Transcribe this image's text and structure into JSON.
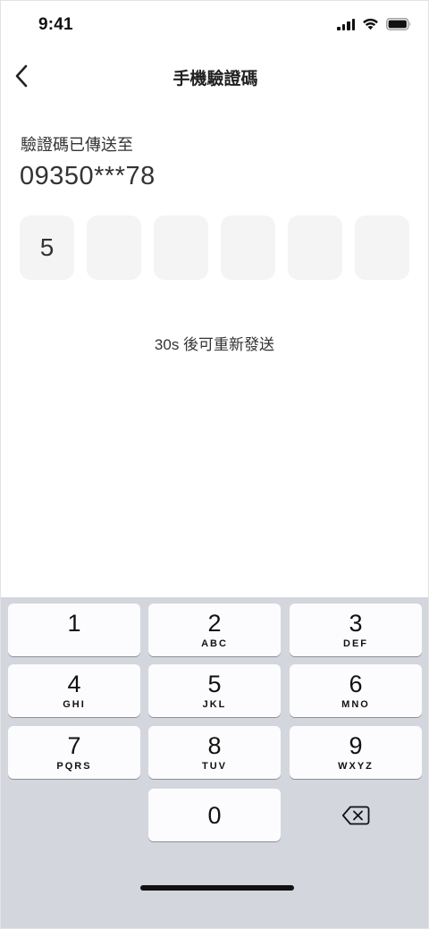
{
  "status_bar": {
    "time": "9:41",
    "icons": [
      "cellular-signal-icon",
      "wifi-icon",
      "battery-icon"
    ]
  },
  "header": {
    "back_icon": "chevron-left-icon",
    "title": "手機驗證碼"
  },
  "verification": {
    "sent_label": "驗證碼已傳送至",
    "phone_number": "09350***78",
    "code_digits": [
      "5",
      "",
      "",
      "",
      "",
      ""
    ],
    "resend_text": "30s 後可重新發送"
  },
  "keypad": {
    "keys": [
      {
        "digit": "1",
        "letters": ""
      },
      {
        "digit": "2",
        "letters": "ABC"
      },
      {
        "digit": "3",
        "letters": "DEF"
      },
      {
        "digit": "4",
        "letters": "GHI"
      },
      {
        "digit": "5",
        "letters": "JKL"
      },
      {
        "digit": "6",
        "letters": "MNO"
      },
      {
        "digit": "7",
        "letters": "PQRS"
      },
      {
        "digit": "8",
        "letters": "TUV"
      },
      {
        "digit": "9",
        "letters": "WXYZ"
      },
      {
        "digit": "0",
        "letters": ""
      }
    ],
    "delete_icon": "backspace-icon"
  },
  "colors": {
    "background": "#ffffff",
    "code_box": "#f4f4f4",
    "keypad_background": "#d3d6dd",
    "key_background": "#fcfcfe",
    "text": "#333333"
  }
}
